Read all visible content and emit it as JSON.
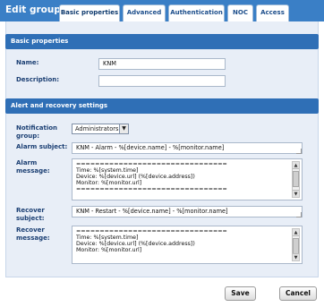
{
  "dialog": {
    "title": "Edit group"
  },
  "tabs": [
    {
      "label": "Basic properties"
    },
    {
      "label": "Advanced"
    },
    {
      "label": "Authentication"
    },
    {
      "label": "NOC"
    },
    {
      "label": "Access"
    }
  ],
  "basic_section": {
    "title": "Basic properties",
    "name_label": "Name:",
    "name_value": "KNM",
    "description_label": "Description:",
    "description_value": ""
  },
  "alert_section": {
    "title": "Alert and recovery settings",
    "notification_label_line1": "Notification",
    "notification_label_line2": "group:",
    "notification_value": "Administrators",
    "alarm_subject_label": "Alarm subject:",
    "alarm_subject_value": "KNM - Alarm - %[device.name] - %[monitor.name]",
    "alarm_message_label_line1": "Alarm",
    "alarm_message_label_line2": "message:",
    "alarm_message_lines": [
      "================================",
      "Time: %[system.time]",
      "Device: %[device.url] (%[device.address])",
      "Monitor: %[monitor.url]",
      "================================"
    ],
    "recover_subject_label_line1": "Recover",
    "recover_subject_label_line2": "subject:",
    "recover_subject_value": "KNM - Restart - %[device.name] - %[monitor.name]",
    "recover_message_label_line1": "Recover",
    "recover_message_label_line2": "message:",
    "recover_message_lines": [
      "================================",
      "Time: %[system.time]",
      "Device: %[device.url] (%[device.address])",
      "Monitor: %[monitor.url]"
    ]
  },
  "footer": {
    "save_label": "Save",
    "cancel_label": "Cancel"
  }
}
